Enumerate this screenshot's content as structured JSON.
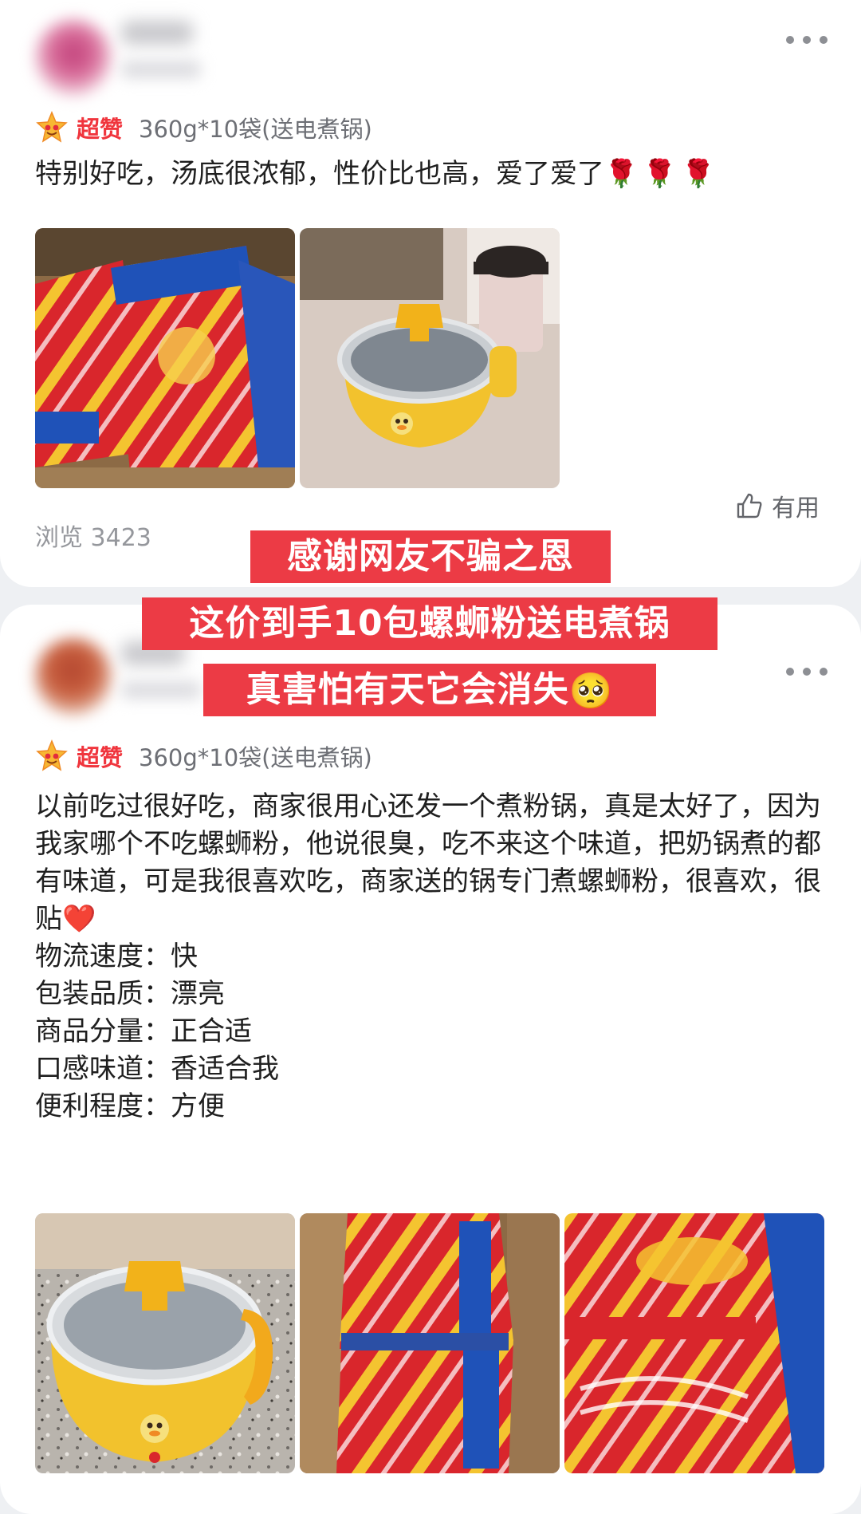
{
  "reviews": [
    {
      "rating_label": "超赞",
      "spec": "360g*10袋(送电煮锅)",
      "text": "特别好吃，汤底很浓郁，性价比也高，爱了爱了",
      "text_emoji": "🌹🌹🌹",
      "views_label": "浏览 3423",
      "helpful_label": "有用"
    },
    {
      "rating_label": "超赞",
      "spec": "360g*10袋(送电煮锅)",
      "text": "以前吃过很好吃，商家很用心还发一个煮粉锅，真是太好了，因为我家哪个不吃螺蛳粉，他说很臭，吃不来这个味道，把奶锅煮的都有味道，可是我很喜欢吃，商家送的锅专门煮螺蛳粉，很喜欢，很贴",
      "text_emoji": "❤️",
      "aspects": [
        "物流速度：快",
        "包装品质：漂亮",
        "商品分量：正合适",
        "口感味道：香适合我",
        "便利程度：方便"
      ]
    }
  ],
  "overlay": {
    "line1": "感谢网友不骗之恩",
    "line2": "这价到手10包螺蛳粉送电煮锅",
    "line3": "真害怕有天它会消失",
    "line3_emoji": "🥺"
  },
  "colors": {
    "rating_red": "#f0353d",
    "overlay_red": "#ec3b45",
    "pot_yellow": "#f2c22d",
    "package_red": "#d7272b",
    "package_blue": "#1f52b8"
  },
  "icons": {
    "rating": "star-face-icon",
    "more": "more-dots-icon",
    "helpful": "thumbs-up-icon"
  }
}
